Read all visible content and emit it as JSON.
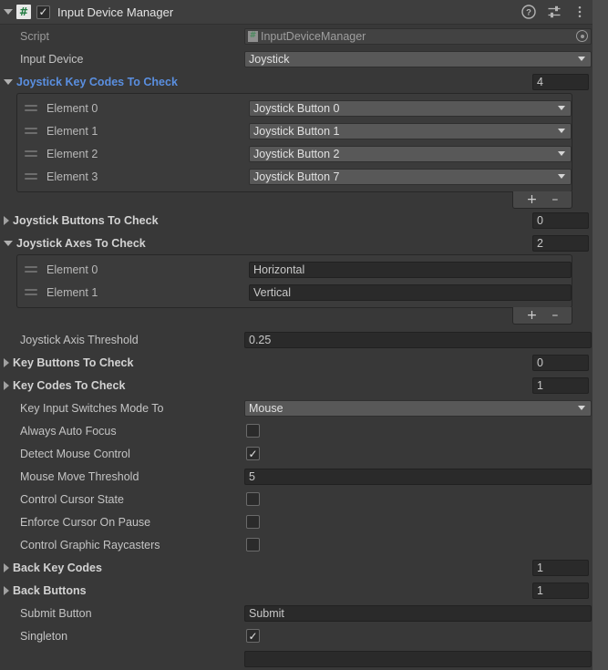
{
  "header": {
    "title": "Input Device Manager",
    "enabled_check": "✓",
    "script_glyph": "#",
    "icons": [
      {
        "name": "help-icon",
        "label": "?"
      },
      {
        "name": "preset-icon",
        "label": "preset"
      },
      {
        "name": "more-menu-icon",
        "label": "⋮"
      }
    ]
  },
  "script_row": {
    "label": "Script",
    "value": "InputDeviceManager",
    "glyph": "#"
  },
  "input_device": {
    "label": "Input Device",
    "value": "Joystick"
  },
  "joystick_key_codes": {
    "label": "Joystick Key Codes To Check",
    "size": "4",
    "expanded": true,
    "elements": [
      {
        "label": "Element 0",
        "value": "Joystick Button 0"
      },
      {
        "label": "Element 1",
        "value": "Joystick Button 1"
      },
      {
        "label": "Element 2",
        "value": "Joystick Button 2"
      },
      {
        "label": "Element 3",
        "value": "Joystick Button 7"
      }
    ],
    "add_label": "+",
    "remove_label": "–"
  },
  "joystick_buttons": {
    "label": "Joystick Buttons To Check",
    "size": "0"
  },
  "joystick_axes": {
    "label": "Joystick Axes To Check",
    "size": "2",
    "elements": [
      {
        "label": "Element 0",
        "value": "Horizontal"
      },
      {
        "label": "Element 1",
        "value": "Vertical"
      }
    ],
    "add_label": "+",
    "remove_label": "–"
  },
  "joystick_axis_threshold": {
    "label": "Joystick Axis Threshold",
    "value": "0.25"
  },
  "key_buttons": {
    "label": "Key Buttons To Check",
    "size": "0"
  },
  "key_codes": {
    "label": "Key Codes To Check",
    "size": "1"
  },
  "key_input_switches_mode_to": {
    "label": "Key Input Switches Mode To",
    "value": "Mouse"
  },
  "always_auto_focus": {
    "label": "Always Auto Focus",
    "checked": false,
    "mark": ""
  },
  "detect_mouse_control": {
    "label": "Detect Mouse Control",
    "checked": true,
    "mark": "✓"
  },
  "mouse_move_threshold": {
    "label": "Mouse Move Threshold",
    "value": "5"
  },
  "control_cursor_state": {
    "label": "Control Cursor State",
    "checked": false,
    "mark": ""
  },
  "enforce_cursor_on_pause": {
    "label": "Enforce Cursor On Pause",
    "checked": false,
    "mark": ""
  },
  "control_graphic_raycasters": {
    "label": "Control Graphic Raycasters",
    "checked": false,
    "mark": ""
  },
  "back_key_codes": {
    "label": "Back Key Codes",
    "size": "1"
  },
  "back_buttons": {
    "label": "Back Buttons",
    "size": "1"
  },
  "submit_button": {
    "label": "Submit Button",
    "value": "Submit"
  },
  "singleton": {
    "label": "Singleton",
    "checked": true,
    "mark": "✓"
  },
  "colors": {
    "background": "#383838",
    "header": "#3e3e3e",
    "field": "#2a2a2a",
    "popup": "#585858",
    "override_blue": "#5a8fe0",
    "gutter": "#4c4c4c"
  }
}
